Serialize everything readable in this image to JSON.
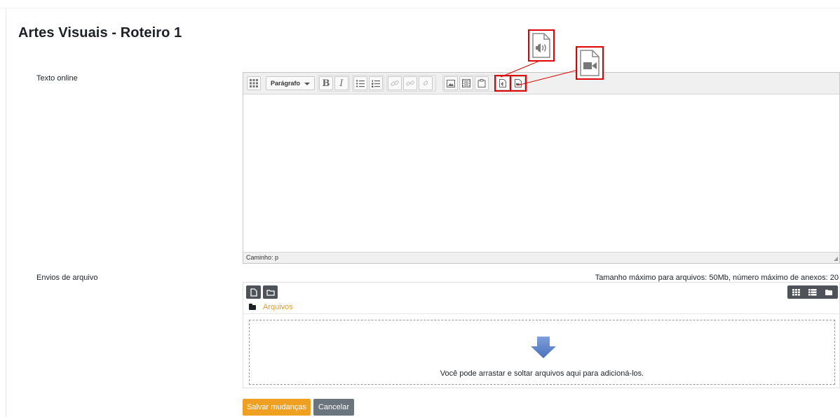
{
  "page": {
    "title": "Artes Visuais - Roteiro 1"
  },
  "online_text": {
    "label": "Texto online",
    "toolbar": {
      "format_select": "Parágrafo",
      "bold": "B",
      "italic": "I"
    },
    "status_path": "Caminho: p"
  },
  "file_upload": {
    "label": "Envios de arquivo",
    "limits": "Tamanho máximo para arquivos: 50Mb, número máximo de anexos: 20",
    "path_folder": "Arquivos",
    "drop_text": "Você pode arrastar e soltar arquivos aqui para adicioná-los."
  },
  "actions": {
    "save_label": "Salvar mudanças",
    "cancel_label": "Cancelar"
  },
  "colors": {
    "accent_orange": "#f0a020",
    "highlight_red": "#e00000",
    "dark_button": "#4d5358",
    "cancel_gray": "#6c757d",
    "drop_arrow": "#5b82c7"
  }
}
